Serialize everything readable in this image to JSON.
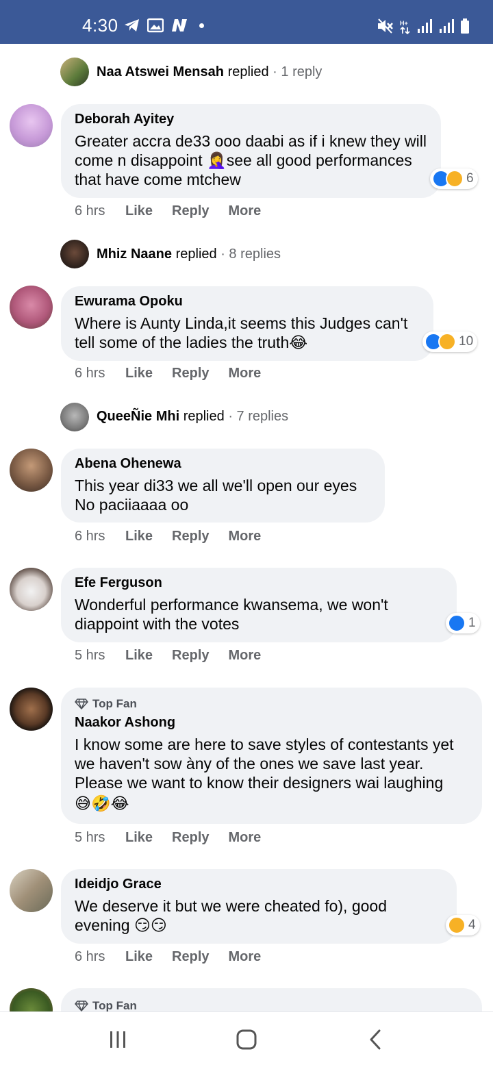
{
  "status_bar": {
    "time": "4:30",
    "left_icons": [
      "telegram-icon",
      "gallery-icon",
      "n-app-icon",
      "notification-dot"
    ],
    "right_icons": [
      "mute-icon",
      "data-arrows-icon",
      "signal-icon",
      "signal-icon-2",
      "battery-icon"
    ],
    "color": "#3b5997"
  },
  "action_labels": {
    "like": "Like",
    "reply": "Reply",
    "more": "More"
  },
  "threads": [
    {
      "type": "reply_summary",
      "name": "Naa Atswei Mensah",
      "verb": "replied",
      "count": "· 1 reply"
    },
    {
      "type": "comment",
      "author": "Deborah Ayitey",
      "text": "Greater accra de33 ooo daabi as if i knew they will come n disappoint 🤦‍♀️see all good performances that have come mtchew",
      "time": "6 hrs",
      "reactions": [
        "like",
        "haha"
      ],
      "reaction_count": "6"
    },
    {
      "type": "reply_summary",
      "name": "Mhiz Naane",
      "verb": "replied",
      "count": "· 8 replies"
    },
    {
      "type": "comment",
      "author": "Ewurama Opoku",
      "text": "Where is Aunty Linda,it seems this Judges can't tell some of the ladies the truth😂",
      "time": "6 hrs",
      "reactions": [
        "like",
        "haha"
      ],
      "reaction_count": "10"
    },
    {
      "type": "reply_summary",
      "name": "QueeÑie Mhi",
      "verb": "replied",
      "count": "· 7 replies"
    },
    {
      "type": "comment",
      "author": "Abena Ohenewa",
      "text": "This year di33 we all we'll open our eyes\nNo paciiaaaa oo",
      "time": "6 hrs"
    },
    {
      "type": "comment",
      "author": "Efe Ferguson",
      "text": "Wonderful performance kwansema, we won't diappoint with the votes",
      "time": "5 hrs",
      "reactions": [
        "like"
      ],
      "reaction_count": "1"
    },
    {
      "type": "comment",
      "badge": "Top Fan",
      "author": "Naakor Ashong",
      "text": "I know some are here to save styles of contestants yet we haven't sow àny of the ones we save last year. Please we want to know their designers wai laughing",
      "emojis": "😅🤣😂",
      "time": "5 hrs"
    },
    {
      "type": "comment",
      "author": "Ideidjo Grace",
      "text": "We deserve it but we were cheated fo), good evening 😏😏",
      "time": "6 hrs",
      "reactions": [
        "haha"
      ],
      "reaction_count": "4"
    },
    {
      "type": "comment_partial",
      "badge": "Top Fan"
    }
  ],
  "nav_bar": {
    "buttons": [
      "recents-button",
      "home-button",
      "back-button"
    ]
  },
  "colors": {
    "bubble": "#f0f2f5",
    "meta_gray": "#65676b",
    "like_blue": "#1877f2",
    "haha_yellow": "#f7b125"
  }
}
